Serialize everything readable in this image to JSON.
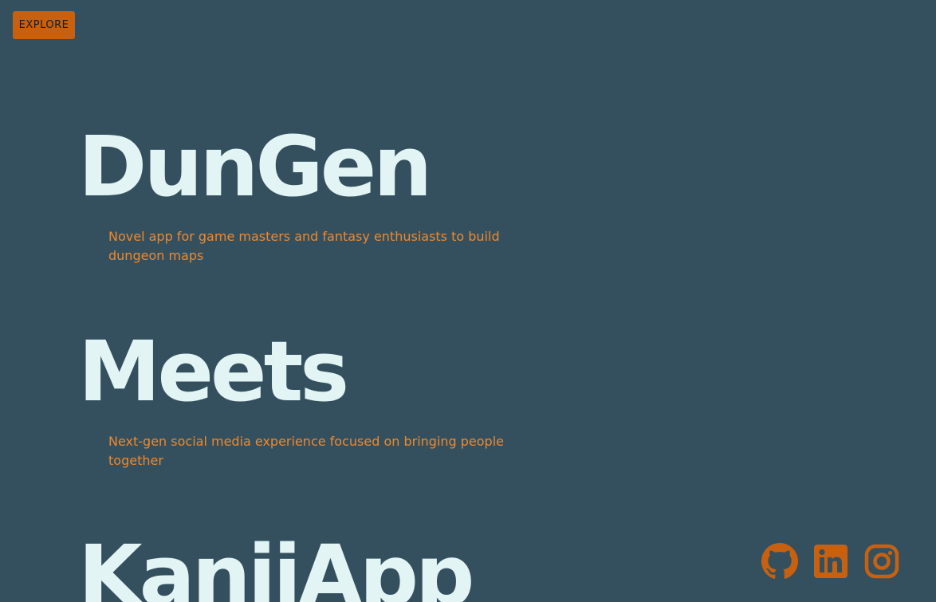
{
  "header": {
    "explore_label": "EXPLORE"
  },
  "projects": [
    {
      "title": "DunGen",
      "description": "Novel app for game masters and fantasy enthusiasts to build dungeon maps"
    },
    {
      "title": "Meets",
      "description": "Next-gen social media experience focused on bringing people together"
    },
    {
      "title": "KanjiApp",
      "description": ""
    }
  ],
  "socials": [
    {
      "icon": "github-icon"
    },
    {
      "icon": "linkedin-icon"
    },
    {
      "icon": "instagram-icon"
    }
  ],
  "colors": {
    "background": "#34505f",
    "title": "#e3f4f4",
    "accent": "#f0882a",
    "button": "#c8610f",
    "icon": "#c8610f"
  }
}
